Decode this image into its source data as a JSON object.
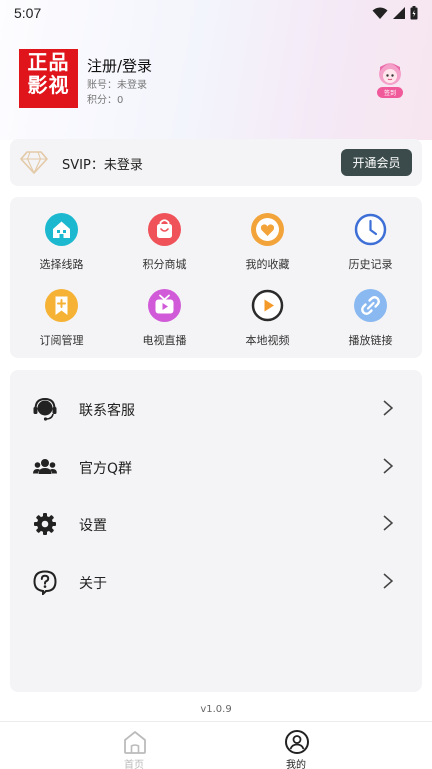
{
  "status_bar": {
    "time": "5:07"
  },
  "profile": {
    "logo_line1": "正品",
    "logo_line2": "影视",
    "name": "注册/登录",
    "account_line": "账号：未登录",
    "points_line": "积分：0",
    "avatar_badge": "签到"
  },
  "svip": {
    "label": "SVIP：未登录",
    "button_label": "开通会员"
  },
  "features": [
    {
      "label": "选择线路",
      "icon": "route-icon",
      "color": "#1bb8cf"
    },
    {
      "label": "积分商城",
      "icon": "shop-bag-icon",
      "color": "#f0525a"
    },
    {
      "label": "我的收藏",
      "icon": "heart-icon",
      "color": "#f2a33a"
    },
    {
      "label": "历史记录",
      "icon": "clock-icon",
      "color": "#3d6fd6"
    },
    {
      "label": "订阅管理",
      "icon": "bookmark-plus-icon",
      "color": "#f5b234"
    },
    {
      "label": "电视直播",
      "icon": "tv-icon",
      "color": "#d05ad8"
    },
    {
      "label": "本地视频",
      "icon": "play-circle-icon",
      "color": "#2b2b2b"
    },
    {
      "label": "播放链接",
      "icon": "link-icon",
      "color": "#5a9be8"
    }
  ],
  "menu": [
    {
      "label": "联系客服",
      "icon": "headset-icon"
    },
    {
      "label": "官方Q群",
      "icon": "group-icon"
    },
    {
      "label": "设置",
      "icon": "gear-icon"
    },
    {
      "label": "关于",
      "icon": "question-icon"
    }
  ],
  "version": "v1.0.9",
  "tabs": [
    {
      "label": "首页",
      "icon": "home-icon",
      "active": false
    },
    {
      "label": "我的",
      "icon": "user-icon",
      "active": true
    }
  ],
  "colors": {
    "accent_dark": "#3b4a4a",
    "card_bg": "#f4f4f6",
    "logo_red": "#e0141b",
    "tab_inactive": "#bbbbbb",
    "tab_active": "#222222"
  }
}
